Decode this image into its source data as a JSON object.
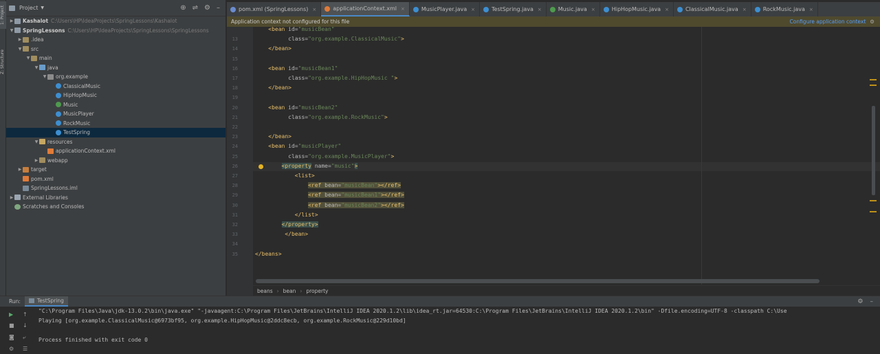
{
  "left_strip": {
    "project_label": "1: Project",
    "structure_label": "Z: Structure"
  },
  "project_pane": {
    "title": "Project",
    "icons": [
      "crosshair-icon",
      "collapse-icon",
      "gear-icon",
      "minimize-icon"
    ],
    "tree": [
      {
        "label": "Kashalot",
        "path": "C:\\Users\\HP\\IdeaProjects\\SpringLessons\\Kashalot",
        "indent": 0,
        "toggle": "▶",
        "icon": "module",
        "bold": true
      },
      {
        "label": "SpringLessons",
        "path": "C:\\Users\\HP\\IdeaProjects\\SpringLessons\\SpringLessons",
        "indent": 0,
        "toggle": "▼",
        "icon": "module",
        "bold": true
      },
      {
        "label": ".idea",
        "path": "",
        "indent": 1,
        "toggle": "▶",
        "icon": "folder"
      },
      {
        "label": "src",
        "path": "",
        "indent": 1,
        "toggle": "▼",
        "icon": "folder"
      },
      {
        "label": "main",
        "path": "",
        "indent": 2,
        "toggle": "▼",
        "icon": "folder"
      },
      {
        "label": "java",
        "path": "",
        "indent": 3,
        "toggle": "▼",
        "icon": "src"
      },
      {
        "label": "org.example",
        "path": "",
        "indent": 4,
        "toggle": "▼",
        "icon": "pkg"
      },
      {
        "label": "ClassicalMusic",
        "path": "",
        "indent": 5,
        "toggle": "",
        "icon": "cls"
      },
      {
        "label": "HipHopMusic",
        "path": "",
        "indent": 5,
        "toggle": "",
        "icon": "cls"
      },
      {
        "label": "Music",
        "path": "",
        "indent": 5,
        "toggle": "",
        "icon": "intf"
      },
      {
        "label": "MusicPlayer",
        "path": "",
        "indent": 5,
        "toggle": "",
        "icon": "cls"
      },
      {
        "label": "RockMusic",
        "path": "",
        "indent": 5,
        "toggle": "",
        "icon": "cls"
      },
      {
        "label": "TestSpring",
        "path": "",
        "indent": 5,
        "toggle": "",
        "icon": "cls",
        "selected": true
      },
      {
        "label": "resources",
        "path": "",
        "indent": 3,
        "toggle": "▼",
        "icon": "res"
      },
      {
        "label": "applicationContext.xml",
        "path": "",
        "indent": 4,
        "toggle": "",
        "icon": "xml"
      },
      {
        "label": "webapp",
        "path": "",
        "indent": 3,
        "toggle": "▶",
        "icon": "folder"
      },
      {
        "label": "target",
        "path": "",
        "indent": 1,
        "toggle": "▶",
        "icon": "target"
      },
      {
        "label": "pom.xml",
        "path": "",
        "indent": 1,
        "toggle": "",
        "icon": "xml"
      },
      {
        "label": "SpringLessons.iml",
        "path": "",
        "indent": 1,
        "toggle": "",
        "icon": "iml"
      },
      {
        "label": "External Libraries",
        "path": "",
        "indent": 0,
        "toggle": "▶",
        "icon": "lib"
      },
      {
        "label": "Scratches and Consoles",
        "path": "",
        "indent": 0,
        "toggle": "",
        "icon": "scratch"
      }
    ]
  },
  "tabs": [
    {
      "label": "pom.xml (SpringLessons)",
      "color": "#6a8ccf",
      "active": false
    },
    {
      "label": "applicationContext.xml",
      "color": "#e07b39",
      "active": true
    },
    {
      "label": "MusicPlayer.java",
      "color": "#3d8fd1",
      "active": false
    },
    {
      "label": "TestSpring.java",
      "color": "#3d8fd1",
      "active": false
    },
    {
      "label": "Music.java",
      "color": "#4e9a4e",
      "active": false
    },
    {
      "label": "HipHopMusic.java",
      "color": "#3d8fd1",
      "active": false
    },
    {
      "label": "ClassicalMusic.java",
      "color": "#3d8fd1",
      "active": false
    },
    {
      "label": "RockMusic.java",
      "color": "#3d8fd1",
      "active": false
    }
  ],
  "notification": {
    "message": "Application context not configured for this file",
    "action": "Configure application context"
  },
  "code_lines": [
    {
      "n": "",
      "html": "    &lt;bean <span class=\"attr\">id=</span><span class=\"val\">\"musicBean\"</span>"
    },
    {
      "n": "13",
      "html": "          <span class=\"attr\">class=</span><span class=\"val\">\"org.example.ClassicalMusic\"</span>&gt;"
    },
    {
      "n": "14",
      "html": "    &lt;/bean&gt;"
    },
    {
      "n": "15",
      "html": ""
    },
    {
      "n": "16",
      "html": "    &lt;bean <span class=\"attr\">id=</span><span class=\"val\">\"musicBean1\"</span>"
    },
    {
      "n": "17",
      "html": "          <span class=\"attr\">class=</span><span class=\"val\">\"org.example.HipHopMusic \"</span>&gt;"
    },
    {
      "n": "18",
      "html": "    &lt;/bean&gt;"
    },
    {
      "n": "19",
      "html": ""
    },
    {
      "n": "20",
      "html": "    &lt;bean <span class=\"attr\">id=</span><span class=\"val\">\"musicBean2\"</span>"
    },
    {
      "n": "21",
      "html": "          <span class=\"attr\">class=</span><span class=\"val\">\"org.example.RockMusic\"</span>&gt;"
    },
    {
      "n": "22",
      "html": ""
    },
    {
      "n": "23",
      "html": "    &lt;/bean&gt;"
    },
    {
      "n": "24",
      "html": "    &lt;bean <span class=\"attr\">id=</span><span class=\"val\">\"musicPlayer\"</span>"
    },
    {
      "n": "25",
      "html": "          <span class=\"attr\">class=</span><span class=\"val\">\"org.example.MusicPlayer\"</span>&gt;"
    },
    {
      "n": "26",
      "html": "        <span class=\"hl\">&lt;property</span> <span class=\"attr\">name=</span><span class=\"val\">\"music\"</span><span class=\"hl\">&gt;</span>"
    },
    {
      "n": "27",
      "html": "            &lt;list&gt;"
    },
    {
      "n": "28",
      "html": "                <span class=\"hl2\">&lt;ref <span class=\"attr\">bean=</span><span class=\"val\">\"musicBean\"</span>&gt;&lt;/ref&gt;</span>"
    },
    {
      "n": "29",
      "html": "                <span class=\"hl2\">&lt;ref <span class=\"attr\">bean=</span><span class=\"val\">\"musicBean1\"</span>&gt;&lt;/ref&gt;</span>"
    },
    {
      "n": "30",
      "html": "                <span class=\"hl2\">&lt;ref <span class=\"attr\">bean=</span><span class=\"val\">\"musicBean2\"</span>&gt;&lt;/ref&gt;</span>"
    },
    {
      "n": "31",
      "html": "            &lt;/list&gt;"
    },
    {
      "n": "32",
      "html": "        <span class=\"hl\">&lt;/property&gt;</span>"
    },
    {
      "n": "33",
      "html": "         &lt;/bean&gt;"
    },
    {
      "n": "34",
      "html": ""
    },
    {
      "n": "35",
      "html": "&lt;/beans&gt;"
    }
  ],
  "breadcrumb": [
    "beans",
    "bean",
    "property"
  ],
  "run": {
    "label": "Run:",
    "tab": "TestSpring",
    "lines": [
      "\"C:\\Program Files\\Java\\jdk-13.0.2\\bin\\java.exe\" \"-javaagent:C:\\Program Files\\JetBrains\\IntelliJ IDEA 2020.1.2\\lib\\idea_rt.jar=64530:C:\\Program Files\\JetBrains\\IntelliJ IDEA 2020.1.2\\bin\" -Dfile.encoding=UTF-8 -classpath C:\\Use",
      "Playing [org.example.ClassicalMusic@6973bf95, org.example.HipHopMusic@2ddc8ecb, org.example.RockMusic@229d10bd]",
      "",
      "Process finished with exit code 0"
    ]
  }
}
